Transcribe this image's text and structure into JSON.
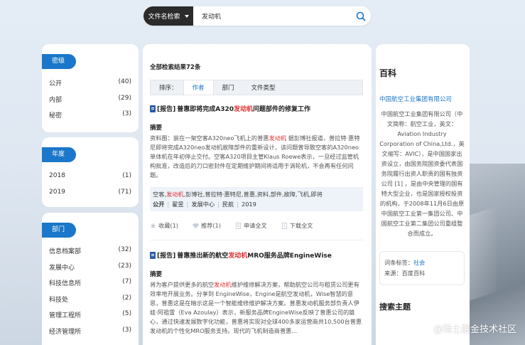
{
  "search": {
    "type_label": "文件名检索",
    "query": "发动机"
  },
  "facets": [
    {
      "title": "密级",
      "items": [
        {
          "label": "公开",
          "count": "(40)"
        },
        {
          "label": "内部",
          "count": "(29)"
        },
        {
          "label": "秘密",
          "count": "(3)"
        }
      ]
    },
    {
      "title": "年度",
      "items": [
        {
          "label": "2018",
          "count": "(1)"
        },
        {
          "label": "2019",
          "count": "(71)"
        }
      ]
    },
    {
      "title": "部门",
      "items": [
        {
          "label": "信息档案部",
          "count": "(32)"
        },
        {
          "label": "发展中心",
          "count": "(23)"
        },
        {
          "label": "科技信息所",
          "count": "(7)"
        },
        {
          "label": "科技处",
          "count": "(2)"
        },
        {
          "label": "管理工程所",
          "count": "(5)"
        },
        {
          "label": "经济管理所",
          "count": "(3)"
        }
      ]
    }
  ],
  "results": {
    "total": "全部检索结果72条",
    "sort_label": "排序：",
    "sort_options": [
      "作者",
      "部门",
      "文件类型"
    ],
    "items": [
      {
        "tag": "[报告]",
        "title_pre": "普惠即将完成A320",
        "title_hl": "发动机",
        "title_post": "问题部件的修复工作",
        "abstract_label": "摘要",
        "abstract_pre": "资料图：装在一架空客A320neo飞机上的普惠",
        "abstract_hl": "发动机",
        "abstract_post": " 据彭博社报道，普拉特·惠特尼即将完成A320neo发动机故障部件的重新设计，该问题曾导致空客的A320neo单体机在年初停止交付。空客A320项目主管Klaus Roewe表示，一旦经过监管机构批准，改造后的刀口密封件在定期维护期间将适用于涡轮机，不会再有任何问题。",
        "keywords_pre": "空客,",
        "keywords_hl": "发动机",
        "keywords_post": ",彭博社,普拉特·惠特尼,普惠,资料,部件,故障,飞机,即将",
        "meta": [
          "公开",
          "翟昱",
          "发展中心",
          "民航",
          "2019"
        ],
        "actions": [
          "收藏(1)",
          "推荐(1)",
          "申请全文",
          "下载全文"
        ]
      },
      {
        "tag": "[报告]",
        "title_pre": "普惠推出新的航空",
        "title_hl": "发动机",
        "title_post": "MRO服务品牌EngineWise",
        "abstract_label": "摘要",
        "abstract_pre": "将为客户提供更多的航空",
        "abstract_hl": "发动机",
        "abstract_post": "维护维修解决方案，帮助航空公司与租赁公司更有效率地开展业务。分享到 EngineWise，Engine是航空发动机，Wise智慧的意思，普惠这是在暗示这是一个智能维修维护解决方案。普惠发动机服务部负责人伊娃·阿祖雷（Eva Azoulay）表示，新服务品牌EngineWise反映了普惠公司的雄心，通过快速发展数字化功能，普惠将实现对全球400多家运营商共10,500台普惠发动机的个性化MRO服务支持。现代的飞机制造商普惠..."
      }
    ]
  },
  "baike": {
    "title": "百科",
    "link": "中国航空工业集团有限公司",
    "text": "中国航空工业集团有限公司（中文简称：航空工业，英文：Aviation Industry Corporation of China,Ltd.，英文缩写：AVIC），是中国国家出资设立，由国务院国资委代表国务院履行出资人职责的国有独资公司 [1] ，是由中央管理的国有特大型企业，也是国家授权投资的机构，于2008年11月6日由原中国航空工业第一集团公司、中国航空工业第二集团公司重组整合而成立。",
    "tag_label": "词条标签：",
    "tag_value": "社会",
    "source_label": "来源：",
    "source_value": "百度百科",
    "theme_title": "搜索主题"
  },
  "watermark": "@稀土掘金技术社区"
}
